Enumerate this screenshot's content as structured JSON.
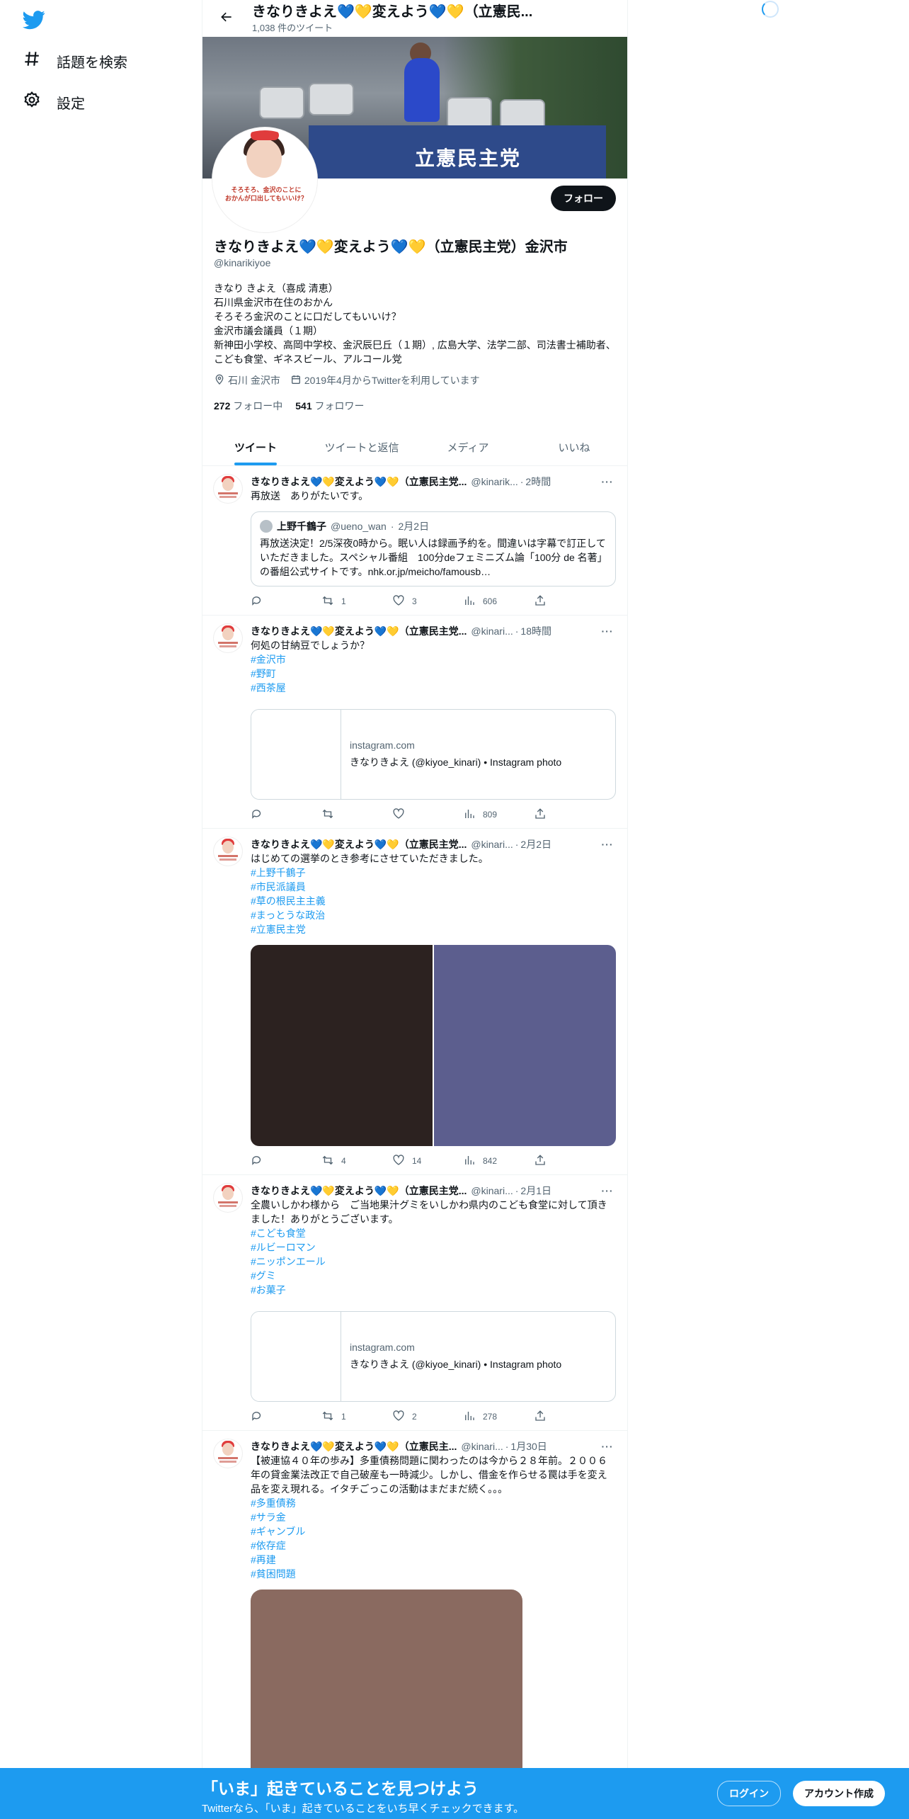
{
  "nav": {
    "logo_icon": "twitter-bird-icon",
    "items": [
      {
        "label": "話題を検索",
        "icon": "hashtag-icon"
      },
      {
        "label": "設定",
        "icon": "gear-icon"
      }
    ]
  },
  "header": {
    "title": "きなりきよえ💙💛変えよう💙💛（立憲民...",
    "tweet_count": "1,038 件のツイート"
  },
  "banner": {
    "truck_text": "立憲民主党"
  },
  "profile": {
    "avatar_text": "そろそろ、金沢のことに\nおかんが口出してもいいけ？",
    "follow_label": "フォロー",
    "display_name": "きなりきよえ💙💛変えよう💙💛（立憲民主党）金沢市",
    "handle": "@kinarikiyoe",
    "bio": "きなり きよえ（喜成 清恵）\n石川県金沢市在住のおかん\nそろそろ金沢のことに口だしてもいいけ？\n金沢市議会議員（１期）\n新神田小学校、高岡中学校、金沢辰巳丘（１期）, 広島大学、法学二部、司法書士補助者、こども食堂、ギネスビール、アルコール党",
    "location": "石川 金沢市",
    "joined": "2019年4月からTwitterを利用しています",
    "following_count": "272",
    "following_label": "フォロー中",
    "followers_count": "541",
    "followers_label": "フォロワー"
  },
  "tabs": [
    "ツイート",
    "ツイートと返信",
    "メディア",
    "いいね"
  ],
  "tweets": [
    {
      "name": "きなりきよえ💙💛変えよう💙💛（立憲民主党...",
      "handle": "@kinarik...",
      "time": "2時間",
      "text": "再放送　ありがたいです。",
      "quote": {
        "name": "上野千鶴子",
        "handle": "@ueno_wan",
        "time": "2月2日",
        "text": "再放送決定！2/5深夜0時から。眠い人は録画予約を。間違いは字幕で訂正していただきました。スペシャル番組　100分deフェミニズム論「100分 de 名著」の番組公式サイトです。nhk.or.jp/meicho/famousb…"
      },
      "reply": "",
      "retweet": "1",
      "like": "3",
      "views": "606"
    },
    {
      "name": "きなりきよえ💙💛変えよう💙💛（立憲民主党...",
      "handle": "@kinari...",
      "time": "18時間",
      "text": "何処の甘納豆でしょうか？",
      "tags": [
        "#金沢市",
        "#野町",
        "#西茶屋"
      ],
      "card": {
        "domain": "instagram.com",
        "title": "きなりきよえ (@kiyoe_kinari) • Instagram photo"
      },
      "reply": "",
      "retweet": "",
      "like": "",
      "views": "809"
    },
    {
      "name": "きなりきよえ💙💛変えよう💙💛（立憲民主党...",
      "handle": "@kinari...",
      "time": "2月2日",
      "text": "はじめての選挙のとき参考にさせていただきました。",
      "tags": [
        "#上野千鶴子",
        "#市民派議員",
        "#草の根民主主義",
        "#まっとうな政治",
        "#立憲民主党"
      ],
      "media_colors": [
        "#2c2220",
        "#5c5e8e"
      ],
      "reply": "",
      "retweet": "4",
      "like": "14",
      "views": "842"
    },
    {
      "name": "きなりきよえ💙💛変えよう💙💛（立憲民主党...",
      "handle": "@kinari...",
      "time": "2月1日",
      "text": "全農いしかわ様から　ご当地果汁グミをいしかわ県内のこども食堂に対して頂きました！ありがとうございます。",
      "tags": [
        "#こども食堂",
        "#ルビーロマン",
        "#ニッポンエール",
        "#グミ",
        "#お菓子"
      ],
      "card": {
        "domain": "instagram.com",
        "title": "きなりきよえ (@kiyoe_kinari) • Instagram photo"
      },
      "reply": "",
      "retweet": "1",
      "like": "2",
      "views": "278"
    },
    {
      "name": "きなりきよえ💙💛変えよう💙💛（立憲民主...",
      "handle": "@kinari...",
      "time": "1月30日",
      "text": "【被連協４０年の歩み】多重債務問題に関わったのは今から２８年前。２００６年の貸金業法改正で自己破産も一時減少。しかし、借金を作らせる罠は手を変え品を変え現れる。イタチごっこの活動はまだまだ続く。。。",
      "tags": [
        "#多重債務",
        "#サラ金",
        "#ギャンブル",
        "#依存症",
        "#再建",
        "#貧困問題"
      ],
      "media_color": "#8a6a60"
    }
  ],
  "bottom_bar": {
    "title": "「いま」起きていることを見つけよう",
    "subtitle": "Twitterなら、「いま」起きていることをいち早くチェックできます。",
    "login_label": "ログイン",
    "signup_label": "アカウント作成"
  },
  "colors": {
    "accent": "#1d9bf0",
    "text": "#0f1419",
    "muted": "#536471"
  }
}
